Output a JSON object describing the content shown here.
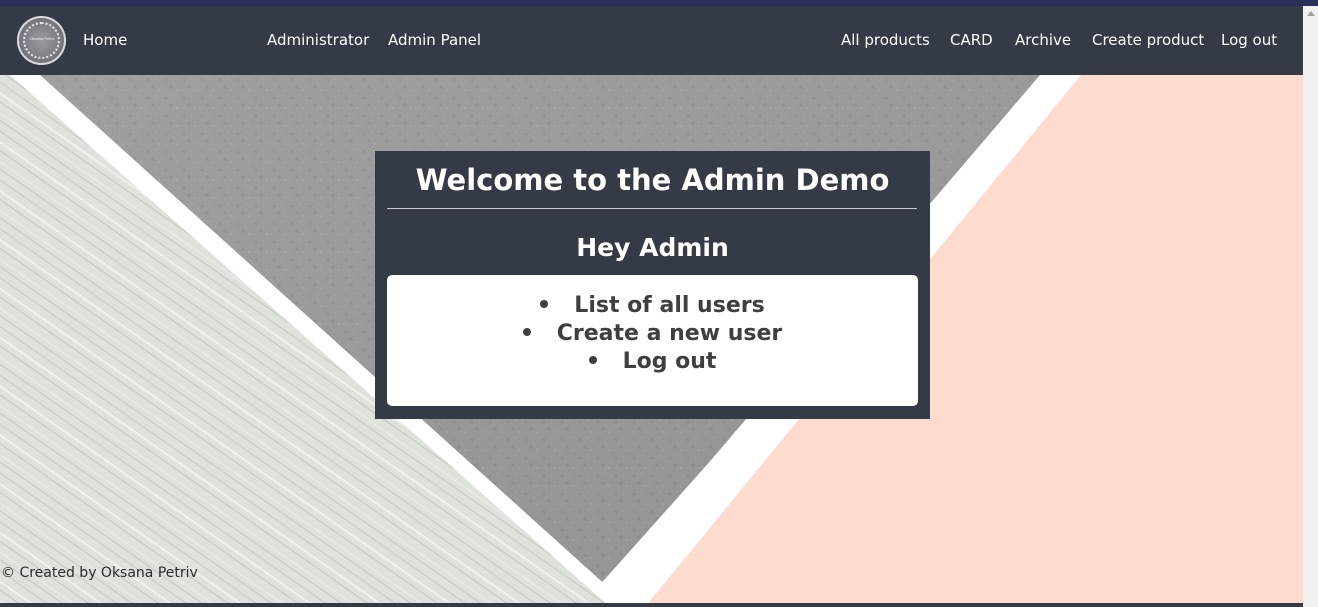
{
  "navbar": {
    "logo_text": "Oksana Petriv",
    "links": {
      "home": "Home",
      "administrator": "Administrator",
      "admin_panel": "Admin Panel",
      "all_products": "All products",
      "card": "CARD",
      "archive": "Archive",
      "create_product": "Create product",
      "log_out": "Log out"
    }
  },
  "card": {
    "title": "Welcome to the Admin Demo",
    "greeting": "Hey Admin",
    "menu": [
      "List of all users",
      "Create a new user",
      "Log out"
    ]
  },
  "footer": {
    "text": "© Created by Oksana Petriv"
  },
  "colors": {
    "navbar_bg": "#343a46",
    "card_bg": "#343a46",
    "peach": "#fedbcf",
    "concrete": "#9b9b9b",
    "wood": "#dfe3dd"
  }
}
